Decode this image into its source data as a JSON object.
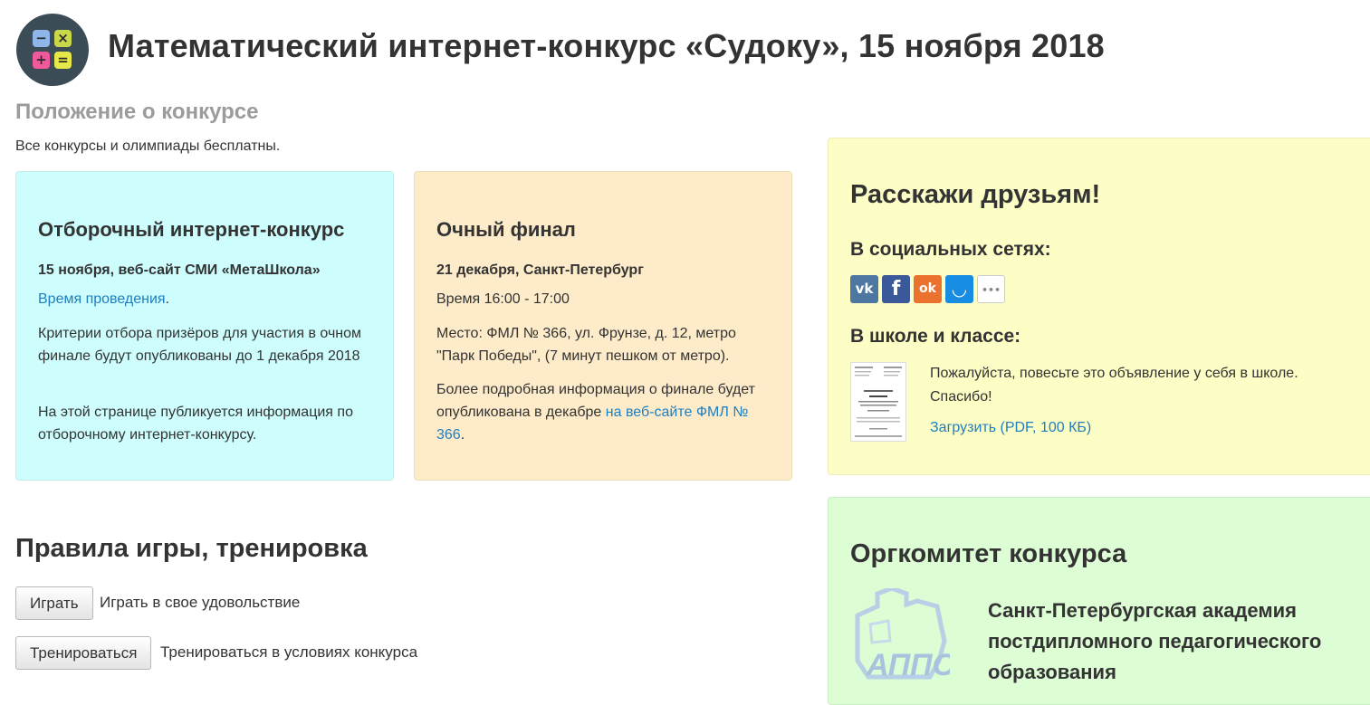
{
  "header": {
    "title": "Математический интернет-конкурс «Судоку», 15 ноября 2018",
    "logo_symbols": [
      "−",
      "×",
      "+",
      "="
    ],
    "logo_colors": [
      "#8fb6e8",
      "#c9d848",
      "#f05a9c",
      "#e6e84a"
    ]
  },
  "rules_link": "Положение о конкурсе",
  "free_note": "Все конкурсы и олимпиады бесплатны.",
  "qualifier": {
    "title": "Отборочный интернет-конкурс",
    "date_place": "15 ноября, веб-сайт СМИ «МетаШкола»",
    "time_link": "Время проведения",
    "time_suffix": ".",
    "criteria": "Критерии отбора призёров для участия в очном финале будут опубликованы до 1 декабря 2018",
    "info": "На этой странице публикуется информация по отборочному интернет-конкурсу."
  },
  "final": {
    "title": "Очный финал",
    "date_place": "21 декабря, Санкт-Петербург",
    "time": "Время 16:00 - 17:00",
    "location": "Место: ФМЛ № 366, ул. Фрунзе, д. 12, метро \"Парк Победы\", (7 минут пешком от метро).",
    "more_prefix": "Более подробная информация о финале будет опубликована в декабре ",
    "more_link": "на веб-сайте ФМЛ № 366",
    "more_suffix": "."
  },
  "share": {
    "title": "Расскажи друзьям!",
    "social_heading": "В социальных сетях:",
    "social_buttons": [
      {
        "name": "vk",
        "glyph": "vk",
        "color": "#4d76a1"
      },
      {
        "name": "facebook",
        "glyph": "f",
        "color": "#3b5998"
      },
      {
        "name": "odnoklassniki",
        "glyph": "ok",
        "color": "#eb722e"
      },
      {
        "name": "moimir",
        "glyph": "◡",
        "color": "#168de2"
      },
      {
        "name": "more",
        "glyph": "•••",
        "color": "#ffffff"
      }
    ],
    "school_heading": "В школе и классе:",
    "school_text": "Пожалуйста, повесьте это объявление у себя в школе. Спасибо!",
    "download_link": "Загрузить (PDF, 100 КБ)"
  },
  "organizer": {
    "title": "Оргкомитет конкурса",
    "name": "Санкт-Петербургская академия постдипломного педагогического образования",
    "logo_text": "АППО"
  },
  "training": {
    "title": "Правила игры, тренировка",
    "play_button": "Играть",
    "play_desc": "Играть в свое удовольствие",
    "train_button": "Тренироваться",
    "train_desc": "Тренироваться в условиях конкурса"
  }
}
